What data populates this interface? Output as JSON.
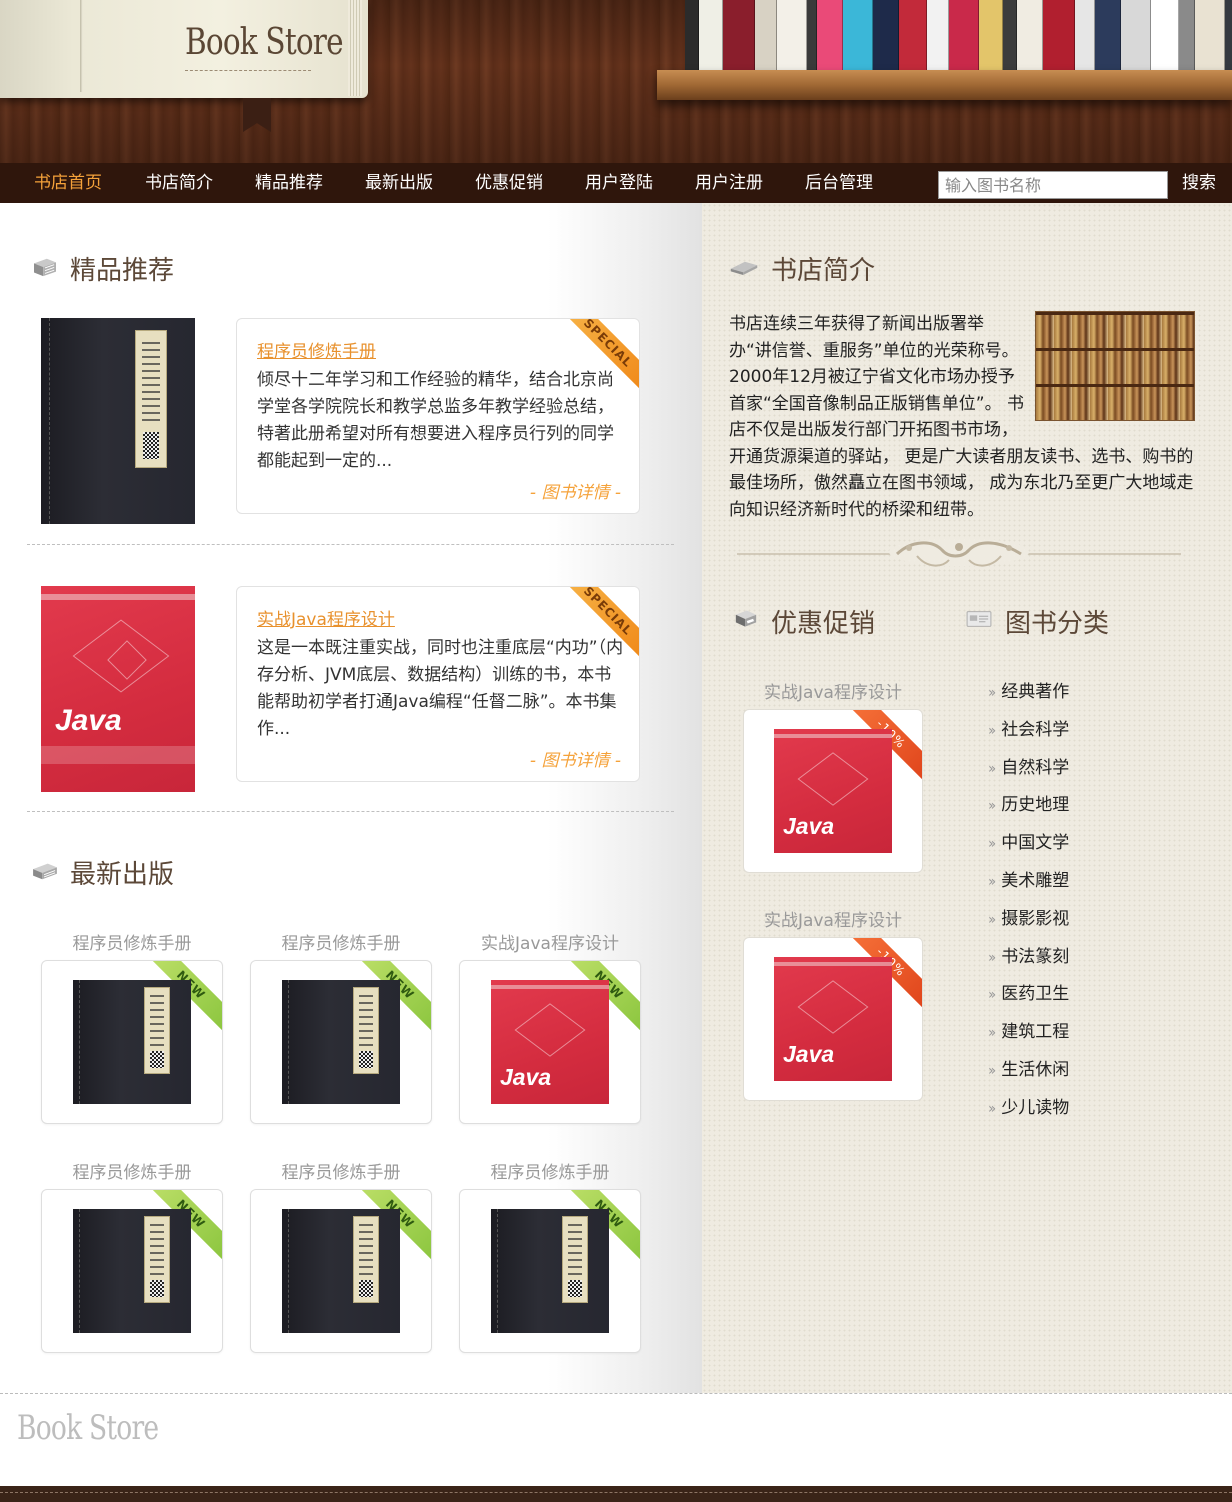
{
  "brand": {
    "logo_text": "Book Store",
    "footer_logo_text": "Book Store"
  },
  "nav": {
    "items": [
      {
        "label": "书店首页",
        "active": true
      },
      {
        "label": "书店简介",
        "active": false
      },
      {
        "label": "精品推荐",
        "active": false
      },
      {
        "label": "最新出版",
        "active": false
      },
      {
        "label": "优惠促销",
        "active": false
      },
      {
        "label": "用户登陆",
        "active": false
      },
      {
        "label": "用户注册",
        "active": false
      },
      {
        "label": "后台管理",
        "active": false
      }
    ],
    "search": {
      "placeholder": "输入图书名称",
      "value": "",
      "button_label": "搜索"
    }
  },
  "featured": {
    "title": "精品推荐",
    "ribbon": "SPECIAL",
    "items": [
      {
        "title": "程序员修炼手册",
        "description": "倾尽十二年学习和工作经验的精华，结合北京尚学堂各学院院长和教学总监多年教学经验总结，特著此册希望对所有想要进入程序员行列的同学都能起到一定的...",
        "link": "- 图书详情 -",
        "cover": "dark"
      },
      {
        "title": "实战Java程序设计",
        "description": "这是一本既注重实战，同时也注重底层“内功”（内存分析、JVM底层、数据结构）训练的书，本书能帮助初学者打通Java编程“任督二脉”。本书集作...",
        "link": "- 图书详情 -",
        "cover": "red"
      }
    ]
  },
  "latest": {
    "title": "最新出版",
    "ribbon": "NEW",
    "items": [
      {
        "title": "程序员修炼手册",
        "cover": "dark"
      },
      {
        "title": "程序员修炼手册",
        "cover": "dark"
      },
      {
        "title": "实战Java程序设计",
        "cover": "red"
      },
      {
        "title": "程序员修炼手册",
        "cover": "dark"
      },
      {
        "title": "程序员修炼手册",
        "cover": "dark"
      },
      {
        "title": "程序员修炼手册",
        "cover": "dark"
      }
    ]
  },
  "about": {
    "title": "书店简介",
    "text": "书店连续三年获得了新闻出版署举办“讲信誉、重服务”单位的光荣称号。2000年12月被辽宁省文化市场办授予首家“全国音像制品正版销售单位”。 书店不仅是出版发行部门开拓图书市场，开通货源渠道的驿站， 更是广大读者朋友读书、选书、购书的最佳场所，傲然矗立在图书领域， 成为东北乃至更广大地域走向知识经济新时代的桥梁和纽带。"
  },
  "promotions": {
    "title": "优惠促销",
    "ribbon": "-10%",
    "items": [
      {
        "title": "实战Java程序设计",
        "cover": "red"
      },
      {
        "title": "实战Java程序设计",
        "cover": "red"
      }
    ]
  },
  "categories": {
    "title": "图书分类",
    "items": [
      "经典著作",
      "社会科学",
      "自然科学",
      "历史地理",
      "中国文学",
      "美术雕塑",
      "摄影影视",
      "书法篆刻",
      "医药卫生",
      "建筑工程",
      "生活休闲",
      "少儿读物"
    ]
  },
  "colors": {
    "accent": "#f5a23a",
    "nav_bg": "#2f160c",
    "title_text": "#5c4838",
    "link": "#e8912d"
  }
}
